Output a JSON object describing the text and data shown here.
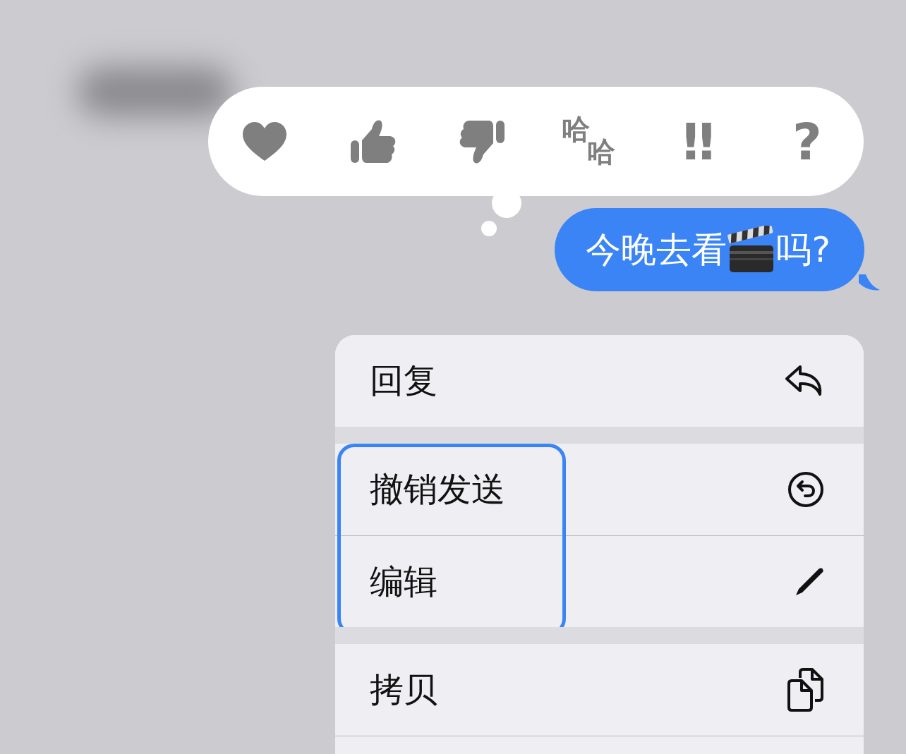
{
  "tapbacks": [
    {
      "kind": "heart"
    },
    {
      "kind": "thumbs-up"
    },
    {
      "kind": "thumbs-down"
    },
    {
      "kind": "haha",
      "glyphs": [
        "哈",
        "哈"
      ]
    },
    {
      "kind": "exclaim",
      "glyph": "‼"
    },
    {
      "kind": "question",
      "glyph": "?"
    }
  ],
  "message": {
    "text_before": "今晚去看",
    "text_after": "吗?"
  },
  "menu": [
    {
      "highlighted": false,
      "items": [
        {
          "label": "回复",
          "kind": "reply"
        }
      ]
    },
    {
      "highlighted": true,
      "items": [
        {
          "label": "撤销发送",
          "kind": "undo"
        },
        {
          "label": "编辑",
          "kind": "pencil"
        }
      ]
    },
    {
      "highlighted": false,
      "items": [
        {
          "label": "拷贝",
          "kind": "copy"
        }
      ]
    }
  ]
}
